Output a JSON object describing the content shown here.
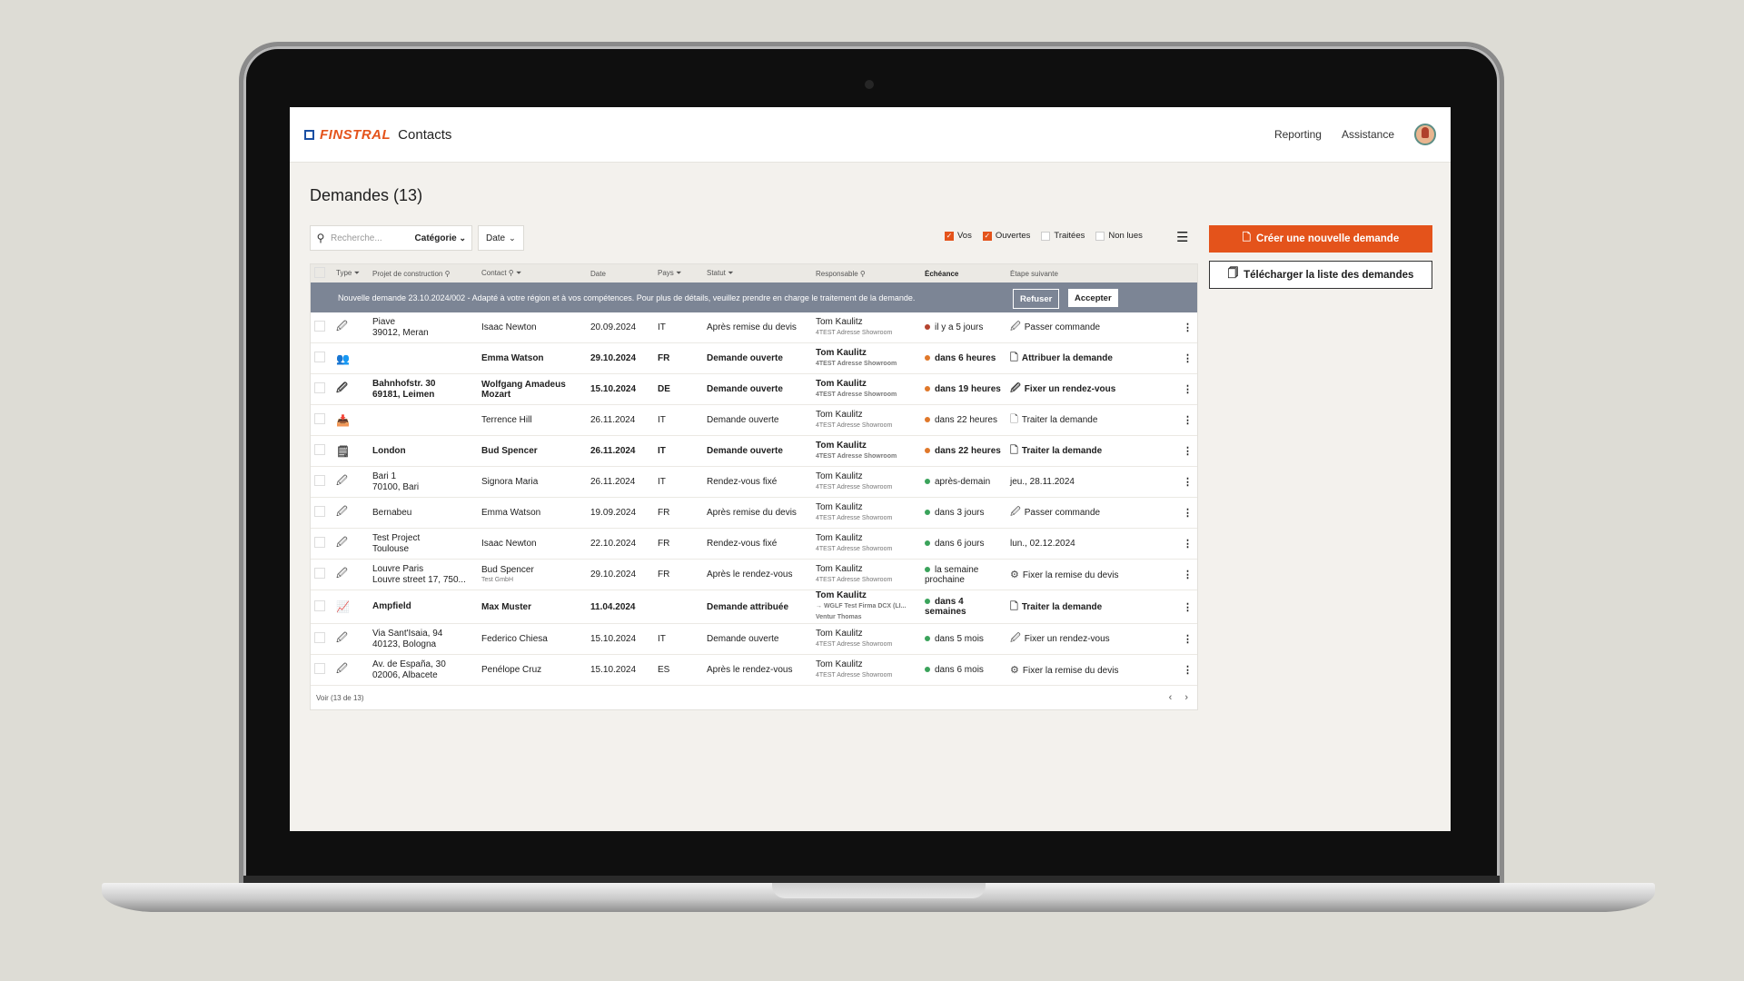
{
  "header": {
    "brand": "FINSTRAL",
    "app": "Contacts",
    "nav": [
      "Reporting",
      "Assistance"
    ]
  },
  "page": {
    "title": "Demandes (13)"
  },
  "filters": {
    "search_placeholder": "Recherche...",
    "category": "Catégorie",
    "date": "Date",
    "checks": [
      {
        "label": "Vos",
        "checked": true
      },
      {
        "label": "Ouvertes",
        "checked": true
      },
      {
        "label": "Traitées",
        "checked": false
      },
      {
        "label": "Non lues",
        "checked": false
      }
    ]
  },
  "actions": {
    "create": "Créer une nouvelle demande",
    "download": "Télécharger la liste des demandes"
  },
  "table": {
    "headers": [
      "Type",
      "Projet de construction",
      "Contact",
      "Date",
      "Pays",
      "Statut",
      "Responsable",
      "Échéance",
      "Étape suivante"
    ],
    "notice": {
      "text": "Nouvelle demande 23.10.2024/002 - Adapté à votre région et à vos compétences. Pour plus de détails, veuillez prendre en charge le traitement de la demande.",
      "refuse": "Refuser",
      "accept": "Accepter"
    },
    "rows": [
      {
        "icon": "document-pen-icon",
        "p1": "Piave",
        "p2": "39012, Meran",
        "contact": "Isaac Newton",
        "csub": "",
        "date": "20.09.2024",
        "country": "IT",
        "status": "Après remise du devis",
        "resp": "Tom Kaulitz",
        "rsub": "4TEST Adresse Showroom",
        "due": "il y a 5 jours",
        "dot": "#b5432f",
        "step_icon": "document-pen-icon",
        "step": "Passer commande",
        "bold": false
      },
      {
        "icon": "people-icon",
        "p1": "",
        "p2": "",
        "contact": "Emma Watson",
        "csub": "",
        "date": "29.10.2024",
        "country": "FR",
        "status": "Demande ouverte",
        "resp": "Tom Kaulitz",
        "rsub": "4TEST Adresse Showroom",
        "due": "dans 6 heures",
        "dot": "#e0782a",
        "step_icon": "document-icon",
        "step": "Attribuer la demande",
        "bold": true
      },
      {
        "icon": "document-pen-icon",
        "p1": "Bahnhofstr. 30",
        "p2": "69181, Leimen",
        "contact": "Wolfgang Amadeus Mozart",
        "csub": "",
        "date": "15.10.2024",
        "country": "DE",
        "status": "Demande ouverte",
        "resp": "Tom Kaulitz",
        "rsub": "4TEST Adresse Showroom",
        "due": "dans 19 heures",
        "dot": "#e0782a",
        "step_icon": "document-pen-icon",
        "step": "Fixer un rendez-vous",
        "bold": true
      },
      {
        "icon": "inbox-icon",
        "p1": "",
        "p2": "",
        "contact": "Terrence Hill",
        "csub": "",
        "date": "26.11.2024",
        "country": "IT",
        "status": "Demande ouverte",
        "resp": "Tom Kaulitz",
        "rsub": "4TEST Adresse Showroom",
        "due": "dans 22 heures",
        "dot": "#e0782a",
        "step_icon": "document-icon",
        "step": "Traiter la demande",
        "bold": false
      },
      {
        "icon": "list-document-icon",
        "p1": "London",
        "p2": "",
        "contact": "Bud Spencer",
        "csub": "",
        "date": "26.11.2024",
        "country": "IT",
        "status": "Demande ouverte",
        "resp": "Tom Kaulitz",
        "rsub": "4TEST Adresse Showroom",
        "due": "dans 22 heures",
        "dot": "#e0782a",
        "step_icon": "document-icon",
        "step": "Traiter la demande",
        "bold": true
      },
      {
        "icon": "document-pen-icon",
        "p1": "Bari 1",
        "p2": "70100, Bari",
        "contact": "Signora Maria",
        "csub": "",
        "date": "26.11.2024",
        "country": "IT",
        "status": "Rendez-vous fixé",
        "resp": "Tom Kaulitz",
        "rsub": "4TEST Adresse Showroom",
        "due": "après-demain",
        "dot": "#3aa35b",
        "step_icon": "",
        "step": "jeu., 28.11.2024",
        "bold": false
      },
      {
        "icon": "document-pen-icon",
        "p1": "Bernabeu",
        "p2": "",
        "contact": "Emma Watson",
        "csub": "",
        "date": "19.09.2024",
        "country": "FR",
        "status": "Après remise du devis",
        "resp": "Tom Kaulitz",
        "rsub": "4TEST Adresse Showroom",
        "due": "dans 3 jours",
        "dot": "#3aa35b",
        "step_icon": "document-pen-icon",
        "step": "Passer commande",
        "bold": false
      },
      {
        "icon": "document-pen-icon",
        "p1": "Test Project",
        "p2": "Toulouse",
        "contact": "Isaac Newton",
        "csub": "",
        "date": "22.10.2024",
        "country": "FR",
        "status": "Rendez-vous fixé",
        "resp": "Tom Kaulitz",
        "rsub": "4TEST Adresse Showroom",
        "due": "dans 6 jours",
        "dot": "#3aa35b",
        "step_icon": "",
        "step": "lun., 02.12.2024",
        "bold": false
      },
      {
        "icon": "document-pen-icon",
        "p1": "Louvre Paris",
        "p2": "Louvre street 17, 750...",
        "contact": "Bud Spencer",
        "csub": "Test GmbH",
        "date": "29.10.2024",
        "country": "FR",
        "status": "Après le rendez-vous",
        "resp": "Tom Kaulitz",
        "rsub": "4TEST Adresse Showroom",
        "due": "la semaine prochaine",
        "dot": "#3aa35b",
        "step_icon": "gear-document-icon",
        "step": "Fixer la remise du devis",
        "bold": false
      },
      {
        "icon": "chart-document-icon",
        "p1": "Ampfield",
        "p2": "",
        "contact": "Max Muster",
        "csub": "",
        "date": "11.04.2024",
        "country": "",
        "status": "Demande attribuée",
        "resp": "Tom Kaulitz",
        "rsub": "→ WGLF Test Firma DCX (LI...",
        "rsub2": "Ventur Thomas",
        "due": "dans 4 semaines",
        "dot": "#3aa35b",
        "step_icon": "document-icon",
        "step": "Traiter la demande",
        "bold": true
      },
      {
        "icon": "document-pen-icon",
        "p1": "Via Sant'Isaia, 94",
        "p2": "40123, Bologna",
        "contact": "Federico Chiesa",
        "csub": "",
        "date": "15.10.2024",
        "country": "IT",
        "status": "Demande ouverte",
        "resp": "Tom Kaulitz",
        "rsub": "4TEST Adresse Showroom",
        "due": "dans 5 mois",
        "dot": "#3aa35b",
        "step_icon": "document-pen-icon",
        "step": "Fixer un rendez-vous",
        "bold": false
      },
      {
        "icon": "document-pen-icon",
        "p1": "Av. de España, 30",
        "p2": "02006, Albacete",
        "contact": "Penélope Cruz",
        "csub": "",
        "date": "15.10.2024",
        "country": "ES",
        "status": "Après le rendez-vous",
        "resp": "Tom Kaulitz",
        "rsub": "4TEST Adresse Showroom",
        "due": "dans 6 mois",
        "dot": "#3aa35b",
        "step_icon": "gear-document-icon",
        "step": "Fixer la remise du devis",
        "bold": false
      }
    ],
    "footer": {
      "view": "Voir",
      "count": "(13 de 13)"
    }
  },
  "colors": {
    "accent": "#e4531b",
    "notice": "#7c8595",
    "brand_blue": "#1a4fa3"
  }
}
